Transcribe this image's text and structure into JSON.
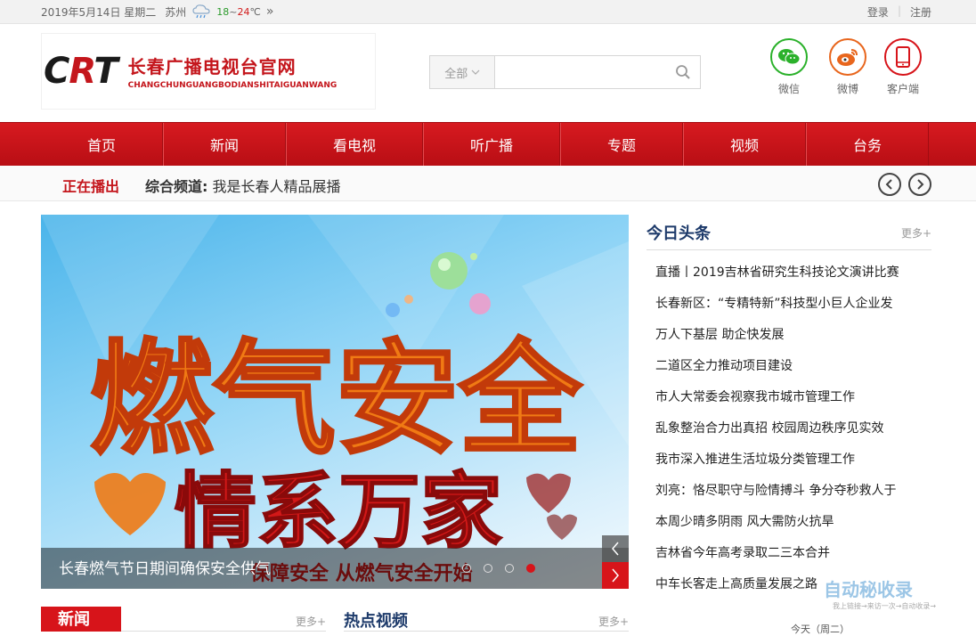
{
  "topbar": {
    "date": "2019年5月14日 星期二",
    "city": "苏州",
    "temp_low": "18",
    "temp_sep": "~",
    "temp_high": "24",
    "temp_unit": "℃",
    "more_glyph": "»",
    "login": "登录",
    "sep": "|",
    "register": "注册"
  },
  "logo": {
    "mark_c": "C",
    "mark_r": "R",
    "mark_t": "T",
    "cn": "长春广播电视台官网",
    "en": "CHANGCHUNGUANGBODIANSHITAIGUANWANG"
  },
  "search": {
    "scope": "全部",
    "placeholder": ""
  },
  "social": [
    {
      "label": "微信",
      "icon": "wechat-icon",
      "color": "#2bb12b"
    },
    {
      "label": "微博",
      "icon": "weibo-icon",
      "color": "#e8661d"
    },
    {
      "label": "客户端",
      "icon": "phone-icon",
      "color": "#d7141a"
    }
  ],
  "nav": [
    "首页",
    "新闻",
    "看电视",
    "听广播",
    "专题",
    "视频",
    "台务"
  ],
  "now_playing": {
    "tag": "正在播出",
    "channel": "综合频道:",
    "program": " 我是长春人精品展播"
  },
  "banner": {
    "headline_1": "燃气安全",
    "headline_2": "情系万家",
    "caption": "长春燃气节日期间确保安全供气",
    "slogan": "保障安全 从燃气安全开始",
    "slide_count": 4,
    "active_slide": 4
  },
  "headlines": {
    "title": "今日头条",
    "more": "更多+",
    "items": [
      "直播丨2019吉林省研究生科技论文演讲比赛",
      "长春新区：“专精特新”科技型小巨人企业发",
      "万人下基层 助企快发展",
      "二道区全力推动项目建设",
      "市人大常委会视察我市城市管理工作",
      "乱象整治合力出真招  校园周边秩序见实效",
      "我市深入推进生活垃圾分类管理工作",
      "刘亮：恪尽职守与险情搏斗 争分夺秒救人于",
      "本周少晴多阴雨 风大需防火抗旱",
      "吉林省今年高考录取二三本合并",
      "中车长客走上高质量发展之路"
    ]
  },
  "news_section": {
    "title": "新闻",
    "more": "更多+"
  },
  "hot_video": {
    "title": "热点视频",
    "more": "更多+"
  },
  "watermark": {
    "line1": "自动秘收录",
    "line2": "我上链接→来访一次→自动收录→"
  },
  "weather_bottom": "今天（周二）",
  "colors": {
    "brand_red": "#d7141a",
    "nav_red": "#c4161c",
    "title_blue": "#1d3a6a"
  }
}
